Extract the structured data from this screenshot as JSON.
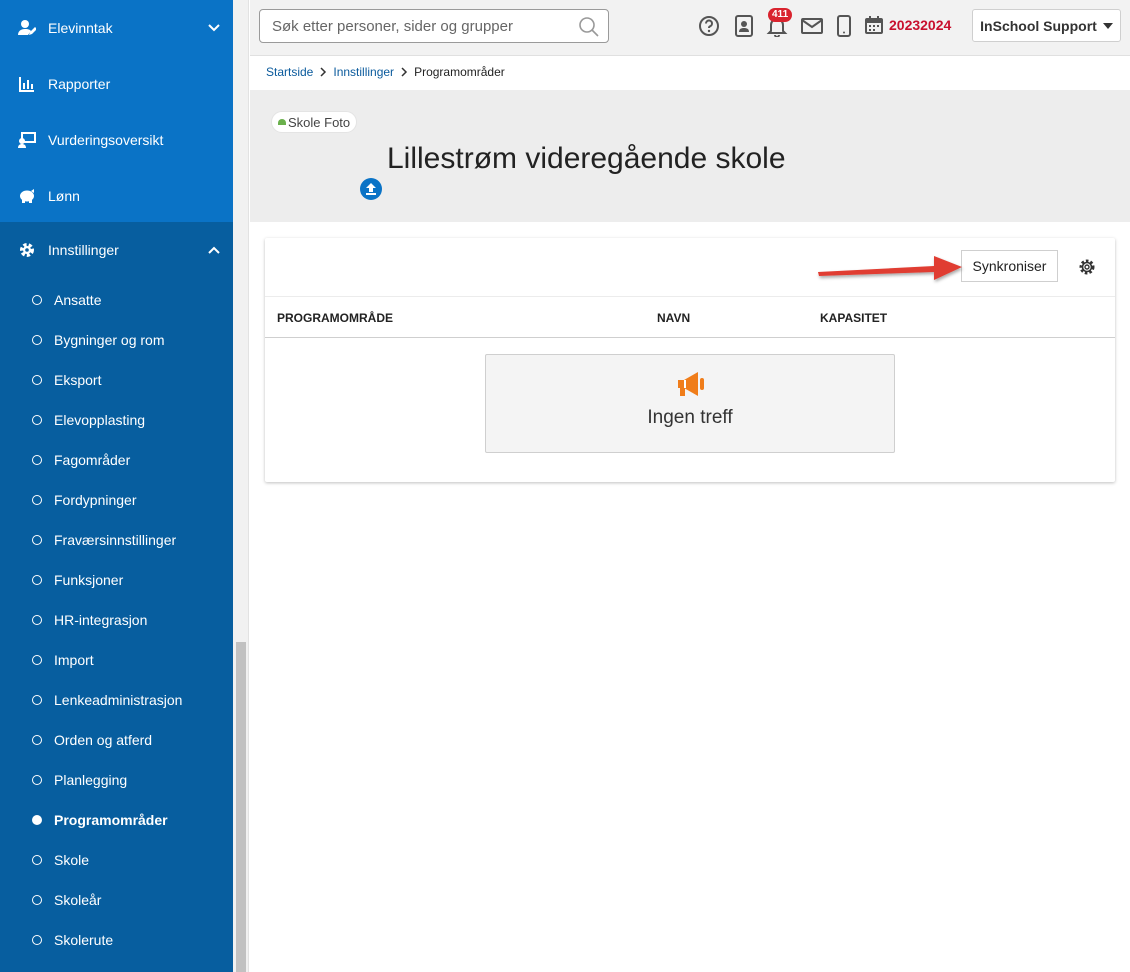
{
  "sidebar": {
    "items": [
      {
        "label": "Elevinntak",
        "icon": "user-edit-icon"
      },
      {
        "label": "Rapporter",
        "icon": "bar-chart-icon"
      },
      {
        "label": "Vurderingsoversikt",
        "icon": "assessment-icon"
      },
      {
        "label": "Lønn",
        "icon": "piggy-bank-icon"
      },
      {
        "label": "Innstillinger",
        "icon": "gear-icon"
      }
    ],
    "sub_items": [
      "Ansatte",
      "Bygninger og rom",
      "Eksport",
      "Elevopplasting",
      "Fagområder",
      "Fordypninger",
      "Fraværsinnstillinger",
      "Funksjoner",
      "HR-integrasjon",
      "Import",
      "Lenkeadministrasjon",
      "Orden og atferd",
      "Planlegging",
      "Programområder",
      "Skole",
      "Skoleår",
      "Skolerute"
    ],
    "active_sub": "Programområder"
  },
  "header": {
    "search_placeholder": "Søk etter personer, sider og grupper",
    "notification_count": "411",
    "school_year": "20232024",
    "user_label": "InSchool Support"
  },
  "breadcrumb": {
    "home": "Startside",
    "settings": "Innstillinger",
    "current": "Programområder"
  },
  "banner": {
    "photo_alt": "Skole Foto",
    "school_name": "Lillestrøm videregående skole"
  },
  "card": {
    "sync_label": "Synkroniser",
    "columns": [
      "PROGRAMOMRÅDE",
      "NAVN",
      "KAPASITET"
    ],
    "empty_text": "Ingen treff"
  },
  "colors": {
    "sidebar_top": "#0a73c6",
    "sidebar": "#075e9f",
    "year": "#c8102e",
    "badge": "#d9232e",
    "megaphone": "#f07d1a",
    "arrow": "#e03c31"
  }
}
